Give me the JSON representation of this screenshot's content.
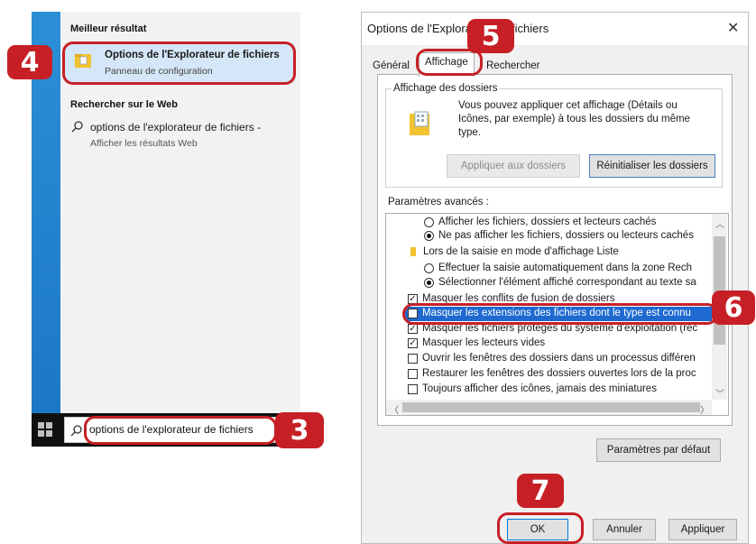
{
  "start_menu": {
    "best_result_header": "Meilleur résultat",
    "best_result": {
      "title": "Options de l'Explorateur de fichiers",
      "subtitle": "Panneau de configuration"
    },
    "web_header": "Rechercher sur le Web",
    "web_result": {
      "title": "options de l'explorateur de fichiers -",
      "subtitle": "Afficher les résultats Web"
    },
    "search_value": "options de l'explorateur de fichiers"
  },
  "dialog": {
    "title": "Options de l'Explorateur de fichiers",
    "close_glyph": "✕",
    "tabs": {
      "general": "Général",
      "affichage": "Affichage",
      "rechercher": "Rechercher"
    },
    "folder_view": {
      "label": "Affichage des dossiers",
      "description": "Vous pouvez appliquer cet affichage (Détails ou Icônes, par exemple) à tous les dossiers du même type.",
      "apply_button": "Appliquer aux dossiers",
      "reset_button": "Réinitialiser les dossiers"
    },
    "advanced_label": "Paramètres avancés :",
    "advanced_items": [
      {
        "text": "Afficher les fichiers, dossiers et lecteurs cachés",
        "kind": "radio",
        "checked": false
      },
      {
        "text": "Ne pas afficher les fichiers, dossiers ou lecteurs cachés",
        "kind": "radio",
        "checked": true
      },
      {
        "text": "Lors de la saisie en mode d'affichage Liste",
        "kind": "folder"
      },
      {
        "text": "Effectuer la saisie automatiquement dans la zone Rech",
        "kind": "radio",
        "checked": false
      },
      {
        "text": "Sélectionner l'élément affiché correspondant au texte sa",
        "kind": "radio",
        "checked": true
      },
      {
        "text": "Masquer les conflits de fusion de dossiers",
        "kind": "checkbox",
        "checked": true
      },
      {
        "text": "Masquer les extensions des fichiers dont le type est connu",
        "kind": "checkbox",
        "checked": false
      },
      {
        "text": "Masquer les fichiers protégés du système d'exploitation (rec",
        "kind": "checkbox",
        "checked": true
      },
      {
        "text": "Masquer les lecteurs vides",
        "kind": "checkbox",
        "checked": true
      },
      {
        "text": "Ouvrir les fenêtres des dossiers dans un processus différen",
        "kind": "checkbox",
        "checked": false
      },
      {
        "text": "Restaurer les fenêtres des dossiers ouvertes lors de la proc",
        "kind": "checkbox",
        "checked": false
      },
      {
        "text": "Toujours afficher des icônes, jamais des miniatures",
        "kind": "checkbox",
        "checked": false
      }
    ],
    "defaults_button": "Paramètres par défaut",
    "ok_button": "OK",
    "cancel_button": "Annuler",
    "apply_button": "Appliquer"
  },
  "annotations": {
    "step3": "3",
    "step4": "4",
    "step5": "5",
    "step6": "6",
    "step7": "7"
  },
  "colors": {
    "annotation_red": "#c62026",
    "selection_blue": "#1e6ad0",
    "start_blue": "#1c78c6"
  }
}
